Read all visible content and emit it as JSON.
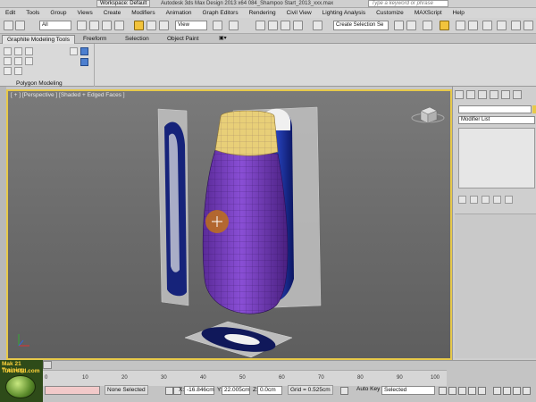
{
  "titlebar": {
    "workspace": "Workspace: Default",
    "title": "Autodesk 3ds Max Design 2013 x64     084_Shampoo Start_2013_xxx.max",
    "search_placeholder": "Type a keyword or phrase"
  },
  "menu": [
    "Edit",
    "Tools",
    "Group",
    "Views",
    "Create",
    "Modifiers",
    "Animation",
    "Graph Editors",
    "Rendering",
    "Civil View",
    "Lighting Analysis",
    "Customize",
    "MAXScript",
    "Help"
  ],
  "toolbar": {
    "filter": "All",
    "refcoord": "View",
    "named_selection": "Create Selection Se"
  },
  "ribbon": {
    "tabs": [
      "Graphite Modeling Tools",
      "Freeform",
      "Selection",
      "Object Paint"
    ],
    "panel_label": "Polygon Modeling"
  },
  "viewport": {
    "label": "[ + ] [Perspective ] [Shaded + Edged Faces ]"
  },
  "command_panel": {
    "modifier_list": "Modifier List"
  },
  "timeline": {
    "slider": "0 / 100",
    "ticks": [
      "0",
      "10",
      "20",
      "30",
      "40",
      "50",
      "60",
      "70",
      "80",
      "90",
      "100"
    ]
  },
  "statusbar": {
    "selection": "None Selected",
    "x_label": "X:",
    "x_value": "-16.846cm",
    "y_label": "Y:",
    "y_value": "22.005cm",
    "z_label": "Z:",
    "z_value": "0.0cm",
    "grid": "Grid = 0.525cm",
    "autokey": "Auto Key",
    "selected": "Selected"
  },
  "logo": {
    "line1": "Mak 21 Training",
    "line2": "Tuturs3d.com"
  },
  "colors": {
    "viewport_border": "#e7c94a",
    "bottle_purple": "#7a3fc2",
    "bottle_cap": "#e8cf78",
    "bottle_blue": "#1b2f9a",
    "cursor": "#c0701a"
  }
}
